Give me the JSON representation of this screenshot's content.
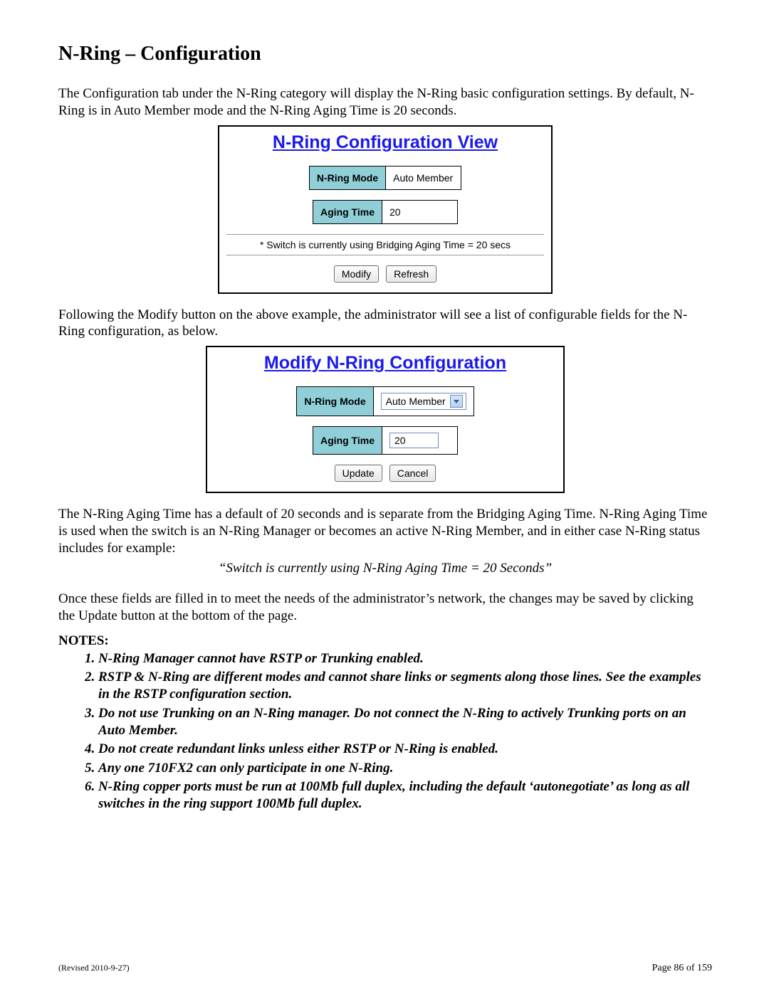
{
  "title": "N-Ring – Configuration",
  "para1": "The Configuration tab under the N-Ring category will display the N-Ring basic configuration settings.  By default, N-Ring is in Auto Member mode and the N-Ring Aging Time is 20 seconds.",
  "panel1": {
    "title": "N-Ring Configuration View",
    "mode_label": "N-Ring Mode",
    "mode_value": "Auto Member",
    "aging_label": "Aging Time",
    "aging_value": "20",
    "status": "* Switch is currently using Bridging Aging Time = 20 secs",
    "modify_btn": "Modify",
    "refresh_btn": "Refresh"
  },
  "para2": "Following the Modify button on the above example, the administrator will see a list of configurable fields for the N-Ring configuration, as below.",
  "panel2": {
    "title": "Modify N-Ring Configuration",
    "mode_label": "N-Ring Mode",
    "mode_value": "Auto Member",
    "aging_label": "Aging Time",
    "aging_value": "20",
    "update_btn": "Update",
    "cancel_btn": "Cancel"
  },
  "para3": "The N-Ring Aging Time has a default of 20 seconds and is separate from the Bridging Aging Time.  N-Ring Aging Time is used when the switch is an N-Ring Manager or becomes an active N-Ring Member, and in either case N-Ring status includes for example:",
  "quote": "“Switch is currently using N-Ring Aging Time = 20 Seconds”",
  "para4": "Once these fields are filled in to meet the needs of the administrator’s network, the changes may be saved by clicking the Update button at the bottom of the page.",
  "notes_label": "NOTES:",
  "notes": [
    "N-Ring Manager cannot have RSTP or Trunking enabled.",
    "RSTP & N-Ring are different modes and cannot share links or segments along those lines.  See the examples in the RSTP configuration section.",
    "Do not use Trunking on an N-Ring manager. Do not connect the N-Ring to actively Trunking ports on an Auto Member.",
    "Do not create redundant links unless either RSTP or N-Ring is enabled.",
    "Any one 710FX2 can only participate in one N-Ring.",
    "N-Ring copper ports must be run at 100Mb full duplex, including the default ‘autonegotiate’ as long as all switches in the ring support 100Mb full duplex."
  ],
  "footer": {
    "revised": "(Revised 2010-9-27)",
    "page": "Page 86 of 159"
  }
}
